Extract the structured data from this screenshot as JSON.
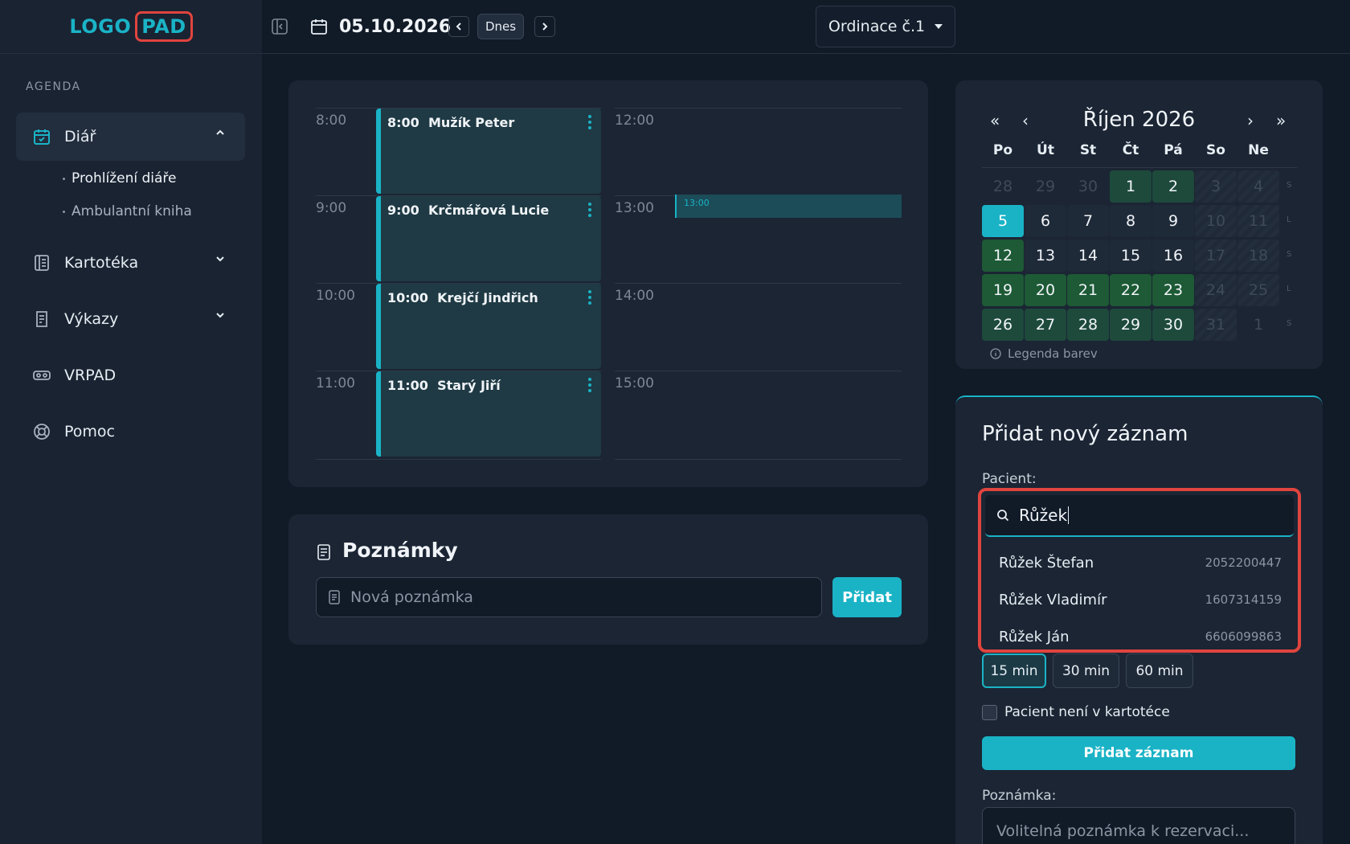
{
  "brand": {
    "logo_part1": "LOGO",
    "logo_part2": "PAD",
    "accent": "#1ab3c6",
    "highlight": "#e0443e"
  },
  "sidebar": {
    "section_label": "AGENDA",
    "items": [
      {
        "label": "Diář",
        "icon": "calendar-check-icon",
        "expanded": true
      },
      {
        "label": "Kartotéka",
        "icon": "card-index-icon",
        "expanded": false
      },
      {
        "label": "Výkazy",
        "icon": "report-icon",
        "expanded": false
      },
      {
        "label": "VRPAD",
        "icon": "vr-headset-icon"
      },
      {
        "label": "Pomoc",
        "icon": "lifebuoy-icon"
      }
    ],
    "subitems": [
      {
        "label": "Prohlížení diáře",
        "active": true
      },
      {
        "label": "Ambulantní kniha",
        "active": false
      }
    ]
  },
  "topbar": {
    "date": "05.10.2026",
    "today_label": "Dnes",
    "office": "Ordinace č.1"
  },
  "schedule": {
    "left_times": [
      "8:00",
      "9:00",
      "10:00",
      "11:00"
    ],
    "right_times": [
      "12:00",
      "13:00",
      "14:00",
      "15:00"
    ],
    "appointments": [
      {
        "time": "8:00",
        "patient": "Mužík Peter"
      },
      {
        "time": "9:00",
        "patient": "Krčmářová Lucie"
      },
      {
        "time": "10:00",
        "patient": "Krejčí Jindřich"
      },
      {
        "time": "11:00",
        "patient": "Starý Jiří"
      }
    ],
    "marker_label": "13:00"
  },
  "notes": {
    "title": "Poznámky",
    "placeholder": "Nová poznámka",
    "add_label": "Přidat"
  },
  "calendar": {
    "month": "Říjen 2026",
    "nav": {
      "first": "«",
      "prev": "‹",
      "next": "›",
      "last": "»"
    },
    "weekdays": [
      "Po",
      "Út",
      "St",
      "Čt",
      "Pá",
      "So",
      "Ne"
    ],
    "weeks": [
      [
        "28",
        "29",
        "30",
        "1",
        "2",
        "3",
        "4"
      ],
      [
        "5",
        "6",
        "7",
        "8",
        "9",
        "10",
        "11"
      ],
      [
        "12",
        "13",
        "14",
        "15",
        "16",
        "17",
        "18"
      ],
      [
        "19",
        "20",
        "21",
        "22",
        "23",
        "24",
        "25"
      ],
      [
        "26",
        "27",
        "28",
        "29",
        "30",
        "31",
        "1"
      ]
    ],
    "week_letters": [
      "S",
      "L",
      "S",
      "L",
      "S"
    ],
    "selected_day": "5",
    "legend_label": "Legenda barev"
  },
  "form": {
    "title": "Přidat nový záznam",
    "patient_label": "Pacient:",
    "search_value": "Růžek",
    "results": [
      {
        "name": "Růžek Štefan",
        "id": "2052200447"
      },
      {
        "name": "Růžek Vladimír",
        "id": "1607314159"
      },
      {
        "name": "Růžek Ján",
        "id": "6606099863"
      }
    ],
    "durations": [
      "15 min",
      "30 min",
      "60 min"
    ],
    "selected_duration": "15 min",
    "not_in_registry_label": "Pacient není v kartotéce",
    "submit_label": "Přidat záznam",
    "note_label": "Poznámka:",
    "note_placeholder": "Volitelná poznámka k rezervaci..."
  }
}
